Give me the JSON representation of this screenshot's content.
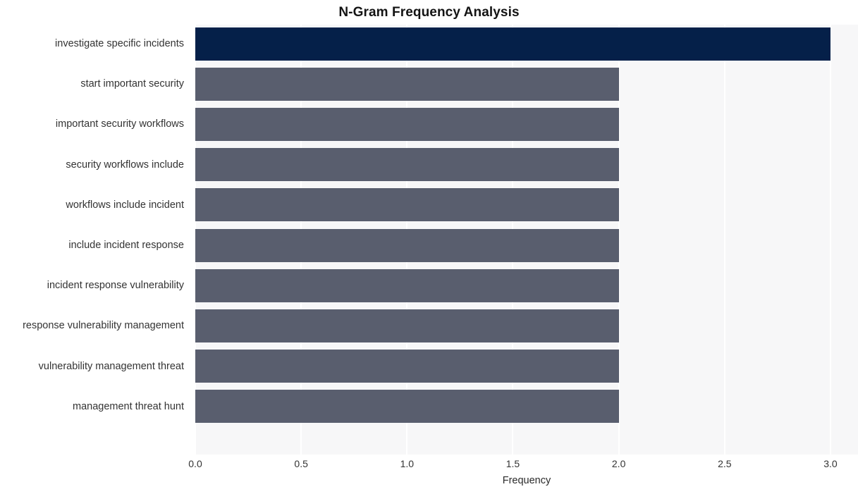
{
  "chart_data": {
    "type": "bar",
    "orientation": "horizontal",
    "title": "N-Gram Frequency Analysis",
    "xlabel": "Frequency",
    "ylabel": "",
    "categories": [
      "investigate specific incidents",
      "start important security",
      "important security workflows",
      "security workflows include",
      "workflows include incident",
      "include incident response",
      "incident response vulnerability",
      "response vulnerability management",
      "vulnerability management threat",
      "management threat hunt"
    ],
    "values": [
      3,
      2,
      2,
      2,
      2,
      2,
      2,
      2,
      2,
      2
    ],
    "xlim": [
      0,
      3.13
    ],
    "xticks": [
      0.0,
      0.5,
      1.0,
      1.5,
      2.0,
      2.5,
      3.0
    ],
    "xticklabels": [
      "0.0",
      "0.5",
      "1.0",
      "1.5",
      "2.0",
      "2.5",
      "3.0"
    ],
    "grid": true,
    "grid_axis": "x",
    "legend": false,
    "bar_colors": [
      "#052049",
      "#595e6e",
      "#595e6e",
      "#595e6e",
      "#595e6e",
      "#595e6e",
      "#595e6e",
      "#595e6e",
      "#595e6e",
      "#595e6e"
    ],
    "colors": {
      "highlight_bar": "#052049",
      "default_bar": "#595e6e",
      "plot_background": "#f7f7f8",
      "figure_background": "#ffffff",
      "gridline": "#ffffff",
      "text": "#333333",
      "title_text": "#141414"
    }
  }
}
